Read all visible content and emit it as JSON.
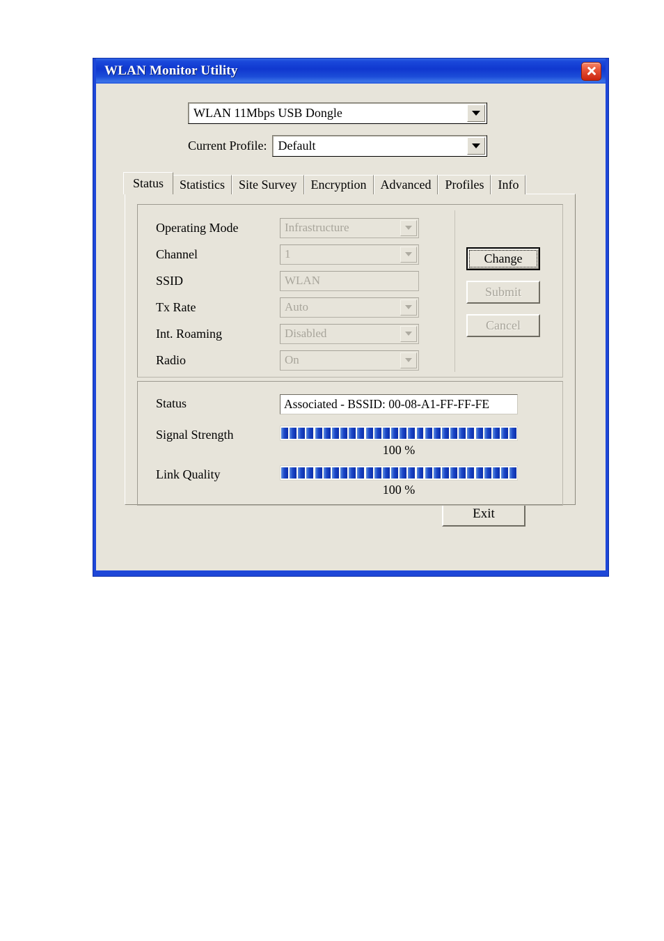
{
  "window": {
    "title": "WLAN Monitor Utility",
    "close_icon": "close-icon",
    "accent_color": "#1038cf",
    "face_color": "#e7e4da"
  },
  "adapter": {
    "selected": "WLAN 11Mbps USB Dongle",
    "arrow_icon": "chevron-down-icon"
  },
  "profile": {
    "label": "Current Profile:",
    "selected": "Default",
    "arrow_icon": "chevron-down-icon"
  },
  "tabs": [
    {
      "label": "Status",
      "active": true
    },
    {
      "label": "Statistics",
      "active": false
    },
    {
      "label": "Site Survey",
      "active": false
    },
    {
      "label": "Encryption",
      "active": false
    },
    {
      "label": "Advanced",
      "active": false
    },
    {
      "label": "Profiles",
      "active": false
    },
    {
      "label": "Info",
      "active": false
    }
  ],
  "settings": {
    "fields": [
      {
        "label": "Operating Mode",
        "value": "Infrastructure",
        "control": "dropdown",
        "disabled": true
      },
      {
        "label": "Channel",
        "value": "1",
        "control": "dropdown",
        "disabled": true
      },
      {
        "label": "SSID",
        "value": "WLAN",
        "control": "text",
        "disabled": true
      },
      {
        "label": "Tx Rate",
        "value": "Auto",
        "control": "dropdown",
        "disabled": true
      },
      {
        "label": "Int. Roaming",
        "value": "Disabled",
        "control": "dropdown",
        "disabled": true
      },
      {
        "label": "Radio",
        "value": "On",
        "control": "dropdown",
        "disabled": true
      }
    ],
    "buttons": {
      "change": "Change",
      "submit": "Submit",
      "cancel": "Cancel"
    }
  },
  "link": {
    "status_label": "Status",
    "status_value": "Associated - BSSID: 00-08-A1-FF-FF-FE",
    "signal_label": "Signal Strength",
    "signal_percent": "100 %",
    "signal_segments": 28,
    "quality_label": "Link Quality",
    "quality_percent": "100 %",
    "quality_segments": 28,
    "bar_color": "#1a46c8"
  },
  "footer": {
    "exit_label": "Exit"
  }
}
